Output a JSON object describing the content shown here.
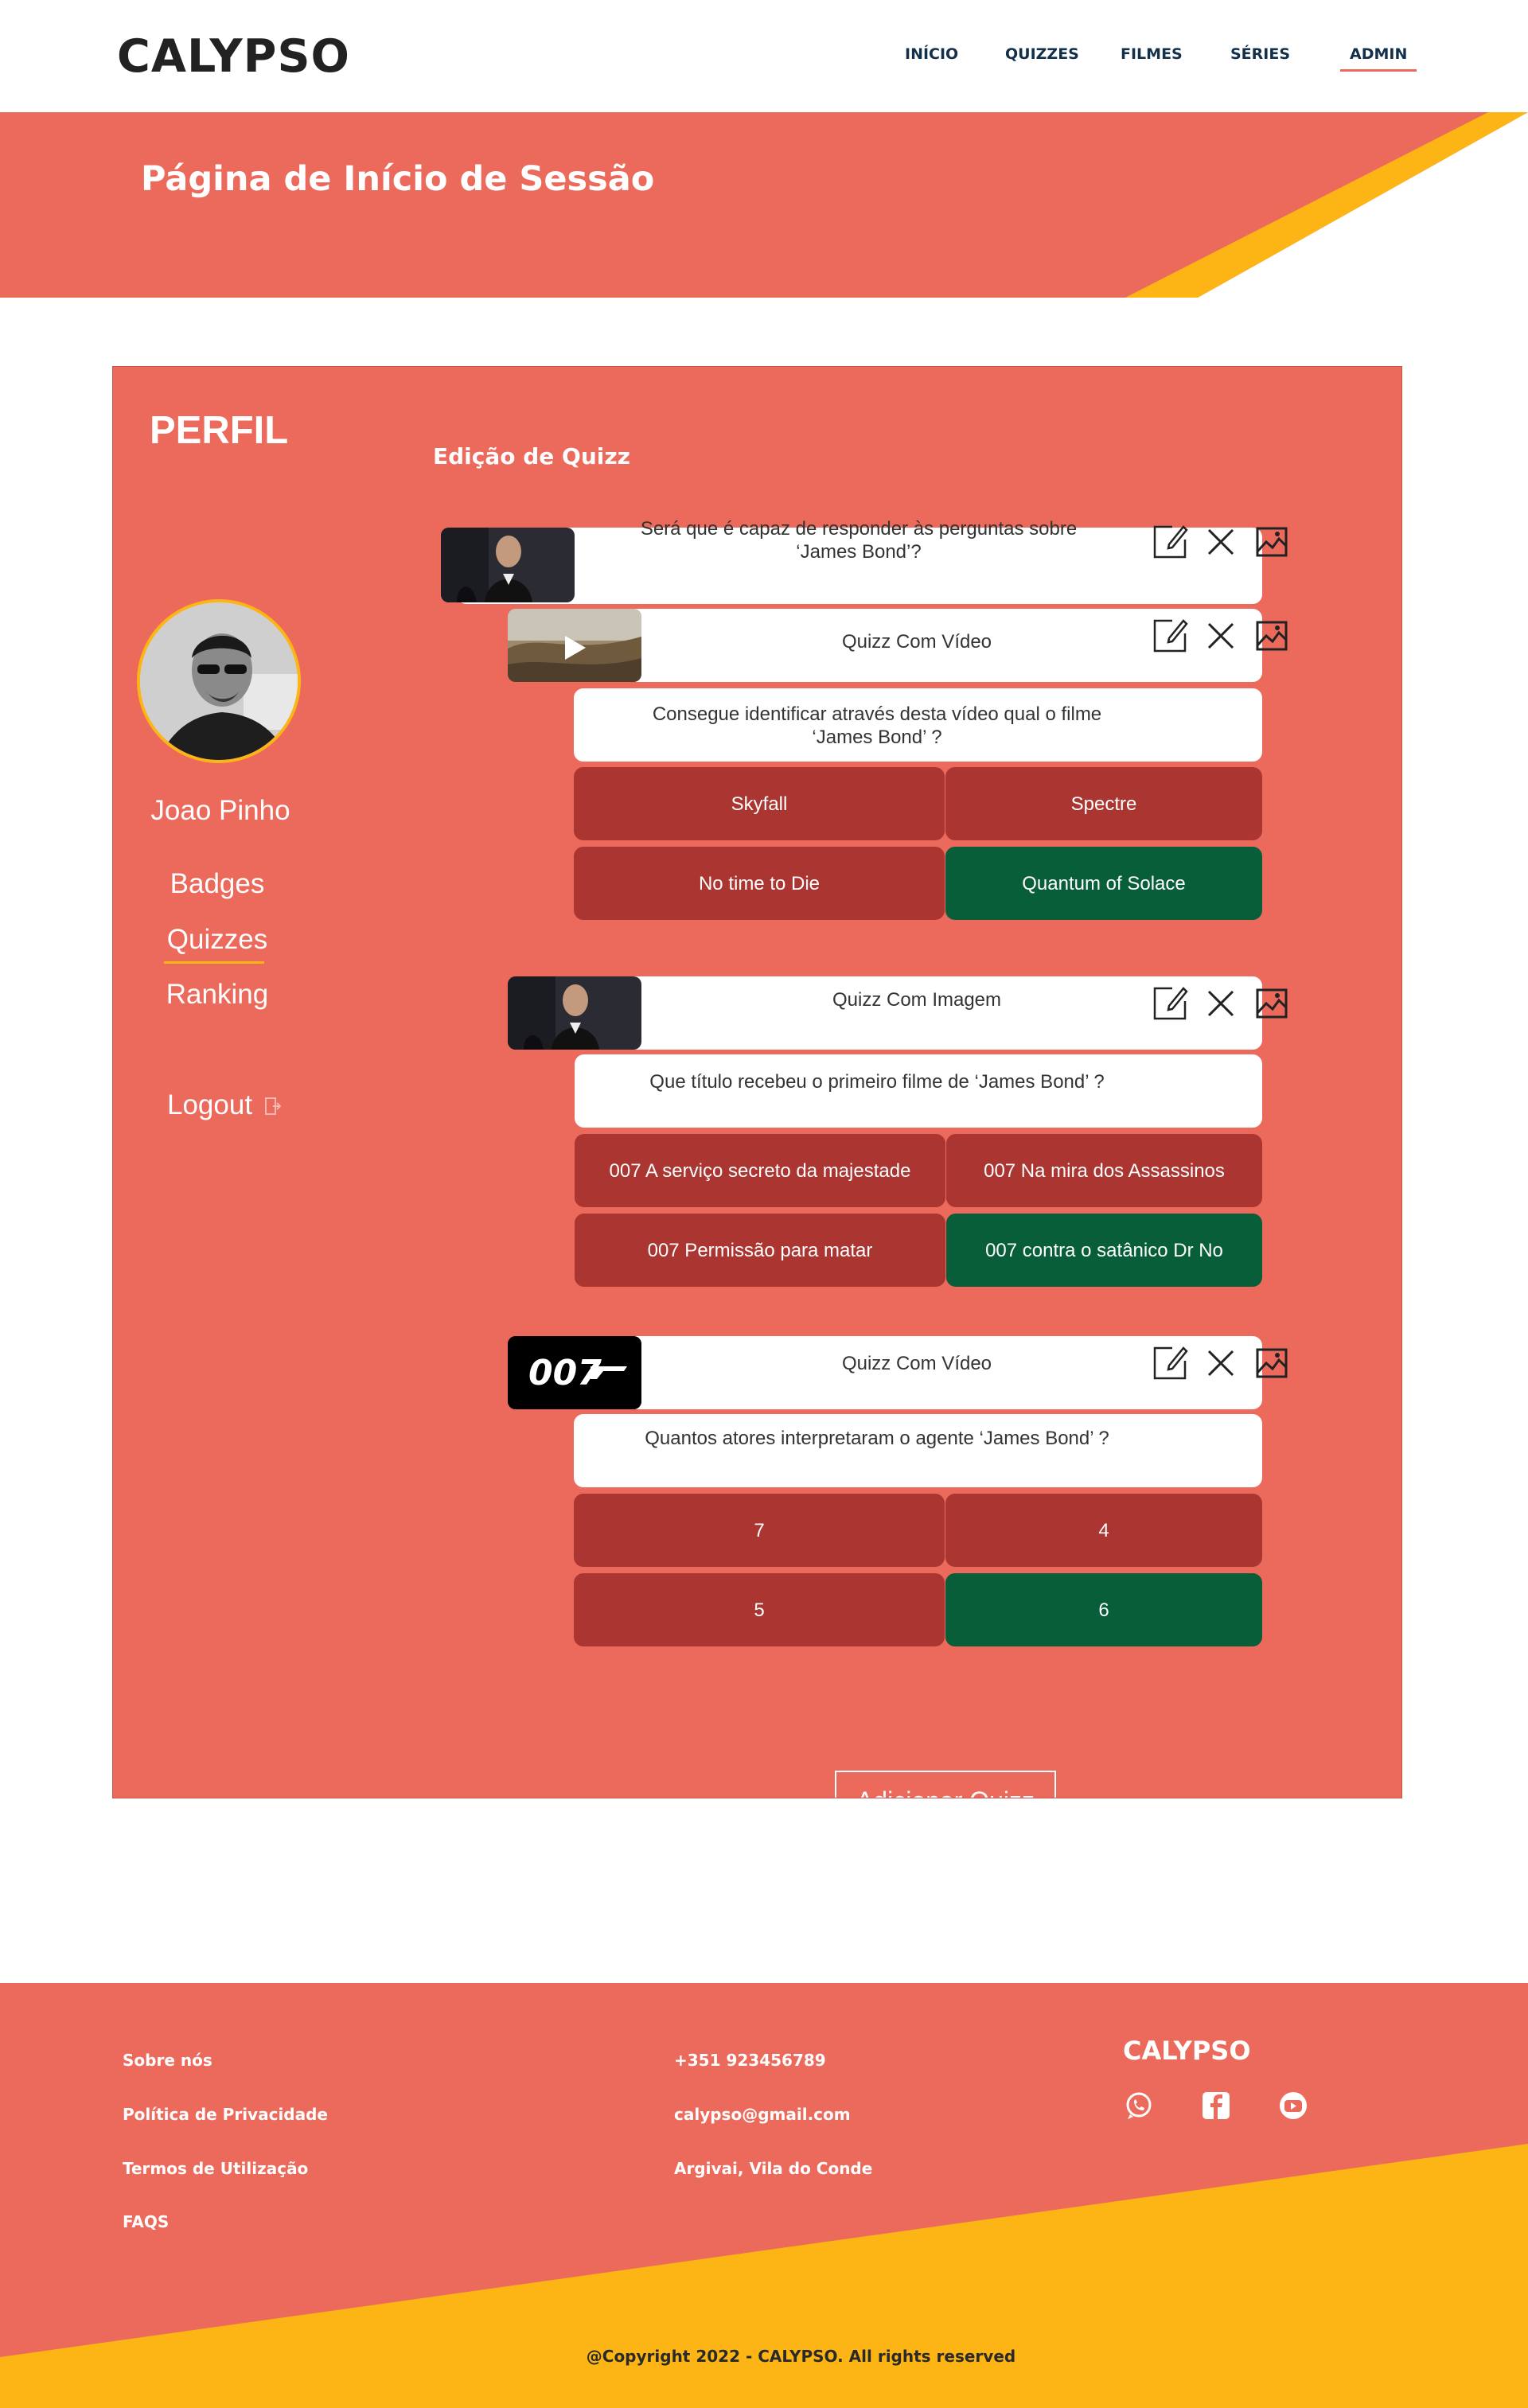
{
  "header": {
    "brand": "CALYPSO",
    "nav": [
      "INÍCIO",
      "QUIZZES",
      "FILMES",
      "SÉRIES",
      "ADMIN"
    ],
    "active_nav": "ADMIN"
  },
  "hero": {
    "title": "Página de Início de Sessão",
    "colors": {
      "coral": "#ec6a5c",
      "yellow": "#fdb515"
    }
  },
  "profile": {
    "heading": "PERFIL",
    "username": "Joao Pinho",
    "menu": [
      "Badges",
      "Quizzes",
      "Ranking"
    ],
    "active_menu": "Quizzes",
    "logout": "Logout"
  },
  "editor": {
    "title": "Edição de Quizz",
    "main_question": "Será que é capaz de responder às perguntas sobre ‘James Bond’?",
    "quizzes": [
      {
        "type_label": "Quizz Com Vídeo",
        "question": "Consegue identificar através desta vídeo qual o filme ‘James Bond’ ?",
        "answers": [
          "Skyfall",
          "Spectre",
          "No time to Die",
          "Quantum of Solace"
        ],
        "correct_index": 3
      },
      {
        "type_label": "Quizz Com Imagem",
        "question": "Que título recebeu o primeiro filme de ‘James Bond’ ?",
        "answers": [
          "007 A serviço secreto da majestade",
          "007 Na mira dos Assassinos",
          "007 Permissão para matar",
          "007 contra o satânico Dr No"
        ],
        "correct_index": 3
      },
      {
        "type_label": "Quizz Com Vídeo",
        "question": "Quantos atores interpretaram o agente ‘James Bond’ ?",
        "answers": [
          "7",
          "4",
          "5",
          "6"
        ],
        "correct_index": 3
      }
    ],
    "logo_text": "007",
    "add_button": "Adicionar Quizz",
    "colors": {
      "wrong": "#ab3531",
      "correct": "#075e38"
    }
  },
  "footer": {
    "links": [
      "Sobre nós",
      "Política de Privacidade",
      "Termos de Utilização",
      "FAQS"
    ],
    "contact": [
      "+351 923456789",
      "calypso@gmail.com",
      "Argivai, Vila do Conde"
    ],
    "brand": "CALYPSO",
    "social": [
      "whatsapp-icon",
      "facebook-icon",
      "youtube-icon"
    ],
    "copyright": "@Copyright 2022 - CALYPSO. All rights reserved"
  }
}
